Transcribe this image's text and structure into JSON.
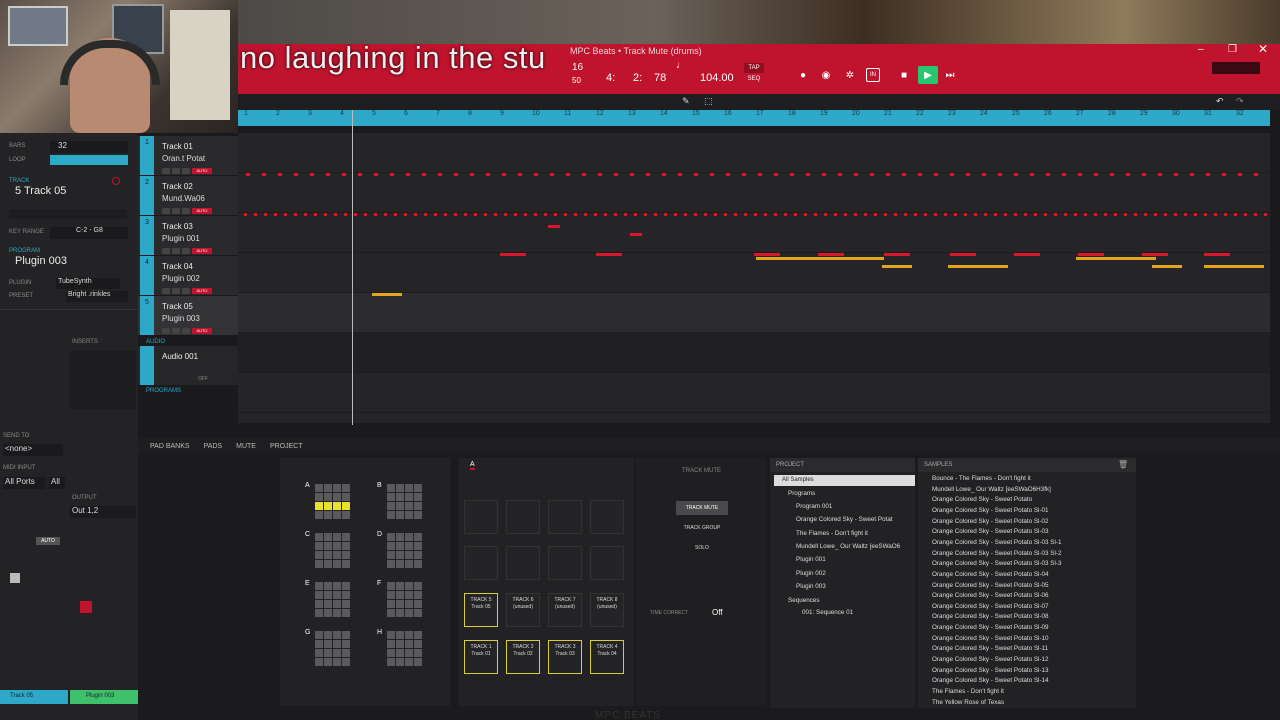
{
  "caption": "no laughing in the stu",
  "window": {
    "title": "MPC Beats • Track Mute (drums)"
  },
  "transport": {
    "bar_label": "16",
    "bars2": "50",
    "position": {
      "bar": "4:",
      "beat": "2:",
      "tick": "78"
    },
    "bpm": "104.00",
    "tap": "TAP",
    "seq": "SEQ"
  },
  "ruler_ticks": [
    "1",
    "2",
    "3",
    "4",
    "5",
    "6",
    "7",
    "8",
    "9",
    "10",
    "11",
    "12",
    "13",
    "14",
    "15",
    "16",
    "17",
    "18",
    "19",
    "20",
    "21",
    "22",
    "23",
    "24",
    "25",
    "26",
    "27",
    "28",
    "29",
    "30",
    "31",
    "32"
  ],
  "left": {
    "bars_label": "Bars",
    "bars_value": "32",
    "loop_label": "Loop",
    "track_section": "TRACK",
    "track_name": "5 Track 05",
    "key_range_label": "Key Range",
    "key_range_value": "C-2 - G8",
    "program_section": "PROGRAM",
    "program_name": "Plugin 003",
    "plugin_label": "Plugin",
    "plugin_value": "TubeSynth",
    "preset_label": "Preset",
    "preset_value": "Bright .rinkles",
    "inserts": "INSERTS",
    "send_to": "SEND TO",
    "send_value": "<none>",
    "midi_input": "MIDI INPUT",
    "midi_ports": "All Ports",
    "midi_all": "All",
    "output": "OUTPUT",
    "output_value": "Out 1,2",
    "auto": "AUTO",
    "strip_track": "Track 05",
    "strip_plugin": "Plugin 003"
  },
  "tracks": [
    {
      "num": "1",
      "name": "Track 01",
      "program": "Oran.t Potat"
    },
    {
      "num": "2",
      "name": "Track 02",
      "program": "Mund.Wa06"
    },
    {
      "num": "3",
      "name": "Track 03",
      "program": "Plugin 001"
    },
    {
      "num": "4",
      "name": "Track 04",
      "program": "Plugin 002"
    },
    {
      "num": "5",
      "name": "Track 05",
      "program": "Plugin 003"
    }
  ],
  "audio_section": "AUDIO",
  "audio_track": {
    "name": "Audio 001",
    "off": "OFF"
  },
  "programs_section": "PROGRAMS",
  "bottom_tabs": [
    "PAD BANKS",
    "PADS",
    "MUTE",
    "PROJECT"
  ],
  "pad_banks": [
    "A",
    "B",
    "C",
    "D",
    "E",
    "F",
    "G",
    "H"
  ],
  "pad_letter": "A",
  "track_pads_top": [
    {
      "l1": "TRACK 5",
      "l2": "Track 05"
    },
    {
      "l1": "TRACK 6",
      "l2": "(unused)"
    },
    {
      "l1": "TRACK 7",
      "l2": "(unused)"
    },
    {
      "l1": "TRACK 8",
      "l2": "(unused)"
    }
  ],
  "track_pads_bottom": [
    {
      "l1": "TRACK 1",
      "l2": "Track 01"
    },
    {
      "l1": "TRACK 2",
      "l2": "Track 02"
    },
    {
      "l1": "TRACK 3",
      "l2": "Track 03"
    },
    {
      "l1": "TRACK 4",
      "l2": "Track 04"
    }
  ],
  "mute_panel": {
    "title": "TRACK MUTE",
    "btn1": "TRACK MUTE",
    "btn2": "TRACK GROUP",
    "btn3": "SOLO",
    "time_correct": "TIME CORRECT",
    "tc_value": "Off"
  },
  "project": {
    "header": "PROJECT",
    "all_samples": "All Samples",
    "programs": "Programs",
    "items": [
      "Program 001",
      "Orange Colored Sky - Sweet Potat",
      "The Flames - Don't fight it",
      "Mundell Lowe_ Our Waltz [eeSWaO6",
      "Plugin 001",
      "Plugin 002",
      "Plugin 003"
    ],
    "sequences": "Sequences",
    "seq_item": "001: Sequence 01"
  },
  "samples": {
    "header": "SAMPLES",
    "items": [
      "Bounce - The Flames - Don't fight it",
      "Mundell Lowe_ Our Waltz [eeSWaO6H3fk]",
      "Orange Colored Sky - Sweet Potato",
      "Orange Colored Sky - Sweet Potato Sl-01",
      "Orange Colored Sky - Sweet Potato Sl-02",
      "Orange Colored Sky - Sweet Potato Sl-03",
      "Orange Colored Sky - Sweet Potato Sl-03 Sl-1",
      "Orange Colored Sky - Sweet Potato Sl-03 Sl-2",
      "Orange Colored Sky - Sweet Potato Sl-03 Sl-3",
      "Orange Colored Sky - Sweet Potato Sl-04",
      "Orange Colored Sky - Sweet Potato Sl-05",
      "Orange Colored Sky - Sweet Potato Sl-06",
      "Orange Colored Sky - Sweet Potato Sl-07",
      "Orange Colored Sky - Sweet Potato Sl-08",
      "Orange Colored Sky - Sweet Potato Sl-09",
      "Orange Colored Sky - Sweet Potato Sl-10",
      "Orange Colored Sky - Sweet Potato Sl-11",
      "Orange Colored Sky - Sweet Potato Sl-12",
      "Orange Colored Sky - Sweet Potato Sl-13",
      "Orange Colored Sky - Sweet Potato Sl-14",
      "The Flames - Don't fight it",
      "The Yellow Rose of Texas"
    ]
  },
  "footer_logo": "MPC BEATS",
  "colors": {
    "accent": "#2ea8c9",
    "brand": "#c0132e",
    "note_red": "#d9162f",
    "note_orange": "#e3a420",
    "pad_yellow": "#e9e22a"
  }
}
